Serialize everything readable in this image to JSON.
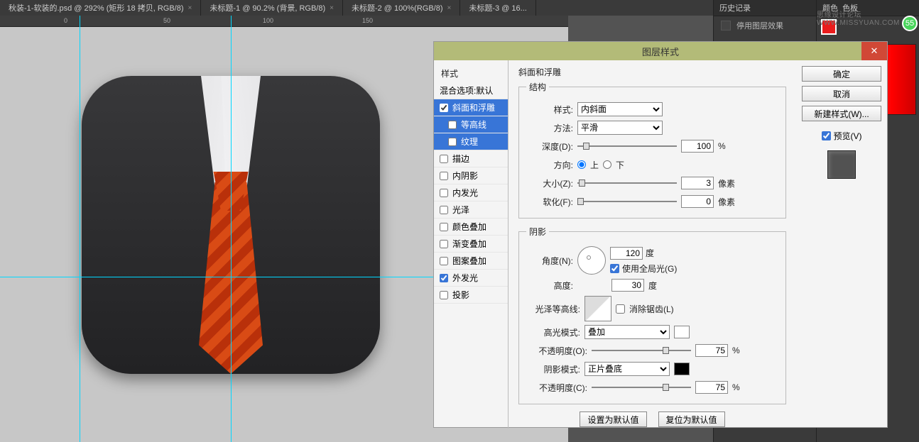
{
  "tabs": [
    {
      "label": "秋装-1-软装的.psd @ 292% (矩形 18 拷贝, RGB/8)"
    },
    {
      "label": "未标题-1 @ 90.2% (背景, RGB/8)"
    },
    {
      "label": "未标题-2 @ 100%(RGB/8)"
    },
    {
      "label": "未标题-3 @ 16..."
    }
  ],
  "panels": {
    "history": {
      "title": "历史记录",
      "entry": "停用图层效果"
    },
    "color": {
      "title": "颜色",
      "swatches_tab": "色板"
    }
  },
  "badge": "55",
  "watermark": "思缘设计论坛 WWW.MISSYUAN.COM",
  "dialog": {
    "title": "图层样式",
    "close": "✕",
    "styles_header": "样式",
    "blending_header": "混合选项:默认",
    "styles": [
      {
        "label": "斜面和浮雕",
        "checked": true,
        "selected": true
      },
      {
        "label": "等高线",
        "checked": false,
        "selected": true
      },
      {
        "label": "纹理",
        "checked": false,
        "selected": true
      },
      {
        "label": "描边",
        "checked": false,
        "selected": false
      },
      {
        "label": "内阴影",
        "checked": false,
        "selected": false
      },
      {
        "label": "内发光",
        "checked": false,
        "selected": false
      },
      {
        "label": "光泽",
        "checked": false,
        "selected": false
      },
      {
        "label": "颜色叠加",
        "checked": false,
        "selected": false
      },
      {
        "label": "渐变叠加",
        "checked": false,
        "selected": false
      },
      {
        "label": "图案叠加",
        "checked": false,
        "selected": false
      },
      {
        "label": "外发光",
        "checked": true,
        "selected": false
      },
      {
        "label": "投影",
        "checked": false,
        "selected": false
      }
    ],
    "section_title": "斜面和浮雕",
    "structure": {
      "legend": "结构",
      "style_label": "样式:",
      "style_value": "内斜面",
      "method_label": "方法:",
      "method_value": "平滑",
      "depth_label": "深度(D):",
      "depth_value": "100",
      "depth_unit": "%",
      "direction_label": "方向:",
      "up_label": "上",
      "down_label": "下",
      "size_label": "大小(Z):",
      "size_value": "3",
      "size_unit": "像素",
      "soften_label": "软化(F):",
      "soften_value": "0",
      "soften_unit": "像素"
    },
    "shading": {
      "legend": "阴影",
      "angle_label": "角度(N):",
      "angle_value": "120",
      "angle_unit": "度",
      "global_light_label": "使用全局光(G)",
      "altitude_label": "高度:",
      "altitude_value": "30",
      "altitude_unit": "度",
      "gloss_label": "光泽等高线:",
      "antialias_label": "消除锯齿(L)",
      "hilite_mode_label": "高光模式:",
      "hilite_mode_value": "叠加",
      "opacity1_label": "不透明度(O):",
      "opacity1_value": "75",
      "opacity1_unit": "%",
      "shadow_mode_label": "阴影模式:",
      "shadow_mode_value": "正片叠底",
      "opacity2_label": "不透明度(C):",
      "opacity2_value": "75",
      "opacity2_unit": "%"
    },
    "bottom": {
      "make_default": "设置为默认值",
      "reset_default": "复位为默认值"
    },
    "actions": {
      "ok": "确定",
      "cancel": "取消",
      "new_style": "新建样式(W)...",
      "preview_label": "预览(V)"
    }
  }
}
